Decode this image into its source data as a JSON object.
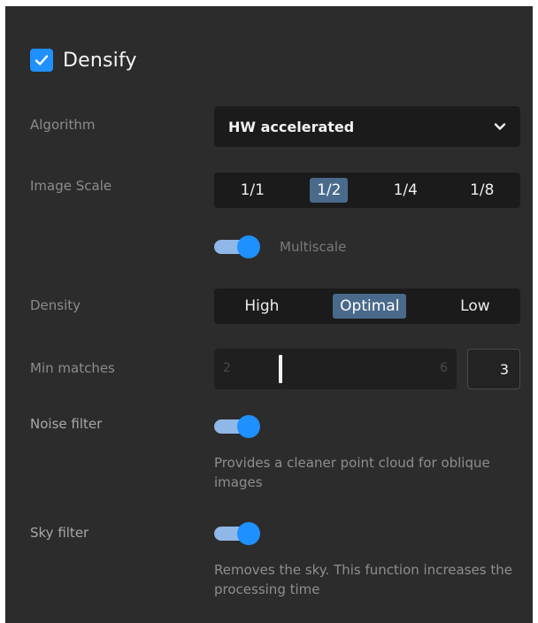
{
  "header": {
    "title": "Densify",
    "checked": true
  },
  "algorithm": {
    "label": "Algorithm",
    "value": "HW accelerated"
  },
  "image_scale": {
    "label": "Image Scale",
    "options": [
      "1/1",
      "1/2",
      "1/4",
      "1/8"
    ],
    "selected": "1/2"
  },
  "multiscale": {
    "label": "Multiscale",
    "enabled": true
  },
  "density": {
    "label": "Density",
    "options": [
      "High",
      "Optimal",
      "Low"
    ],
    "selected": "Optimal"
  },
  "min_matches": {
    "label": "Min matches",
    "min": "2",
    "max": "6",
    "value": "3",
    "numeric_min": 2,
    "numeric_max": 6,
    "numeric_value": 3
  },
  "noise_filter": {
    "label": "Noise filter",
    "enabled": true,
    "description": "Provides a cleaner point cloud for oblique images"
  },
  "sky_filter": {
    "label": "Sky filter",
    "enabled": true,
    "description": "Removes the sky. This function increases the processing time"
  },
  "colors": {
    "accent": "#1e90ff",
    "panel_bg": "#2c2c2c",
    "control_bg": "#1b1b1b",
    "segment_active": "#4a6a8c"
  },
  "icons": {
    "checkbox": "check-icon",
    "dropdown": "chevron-down-icon"
  }
}
